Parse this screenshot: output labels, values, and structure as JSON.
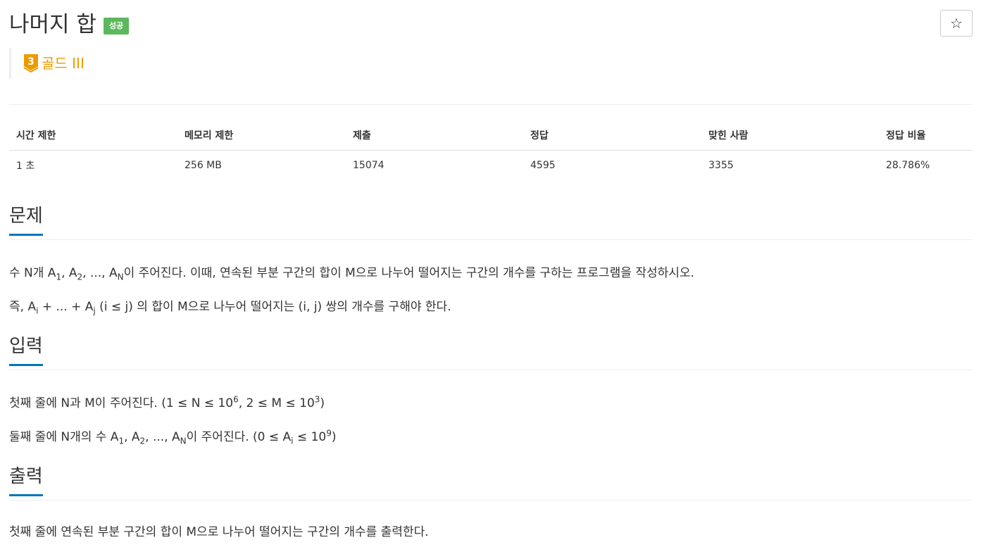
{
  "header": {
    "title": "나머지 합",
    "badge": "성공",
    "star_glyph": "☆"
  },
  "tier": {
    "number": "3",
    "label": "골드 III",
    "color": "#ec9a00"
  },
  "table": {
    "headers": [
      "시간 제한",
      "메모리 제한",
      "제출",
      "정답",
      "맞힌 사람",
      "정답 비율"
    ],
    "row": [
      "1 초",
      "256 MB",
      "15074",
      "4595",
      "3355",
      "28.786%"
    ]
  },
  "problem": {
    "title": "문제",
    "p1": {
      "t1": "수 N개 A",
      "s1": "1",
      "t2": ", A",
      "s2": "2",
      "t3": ", ..., A",
      "s3": "N",
      "t4": "이 주어진다. 이때, 연속된 부분 구간의 합이 M으로 나누어 떨어지는 구간의 개수를 구하는 프로그램을 작성하시오."
    },
    "p2": {
      "t1": "즉, A",
      "s1": "i",
      "t2": " + ... + A",
      "s2": "j",
      "t3": " (i ≤ j) 의 합이 M으로 나누어 떨어지는 (i, j) 쌍의 개수를 구해야 한다."
    }
  },
  "input": {
    "title": "입력",
    "p1": {
      "t1": "첫째 줄에 N과 M이 주어진다. (1 ≤ N ≤ 10",
      "e1": "6",
      "t2": ", 2 ≤ M ≤ 10",
      "e2": "3",
      "t3": ")"
    },
    "p2": {
      "t1": "둘째 줄에 N개의 수 A",
      "s1": "1",
      "t2": ", A",
      "s2": "2",
      "t3": ", ..., A",
      "s3": "N",
      "t4": "이 주어진다. (0 ≤ A",
      "s4": "i",
      "t5": " ≤ 10",
      "e1": "9",
      "t6": ")"
    }
  },
  "output": {
    "title": "출력",
    "p1": "첫째 줄에 연속된 부분 구간의 합이 M으로 나누어 떨어지는 구간의 개수를 출력한다."
  },
  "colors": {
    "success_badge": "#5cb85c",
    "section_underline": "#0076c0",
    "tier_gold": "#ec9a00"
  }
}
